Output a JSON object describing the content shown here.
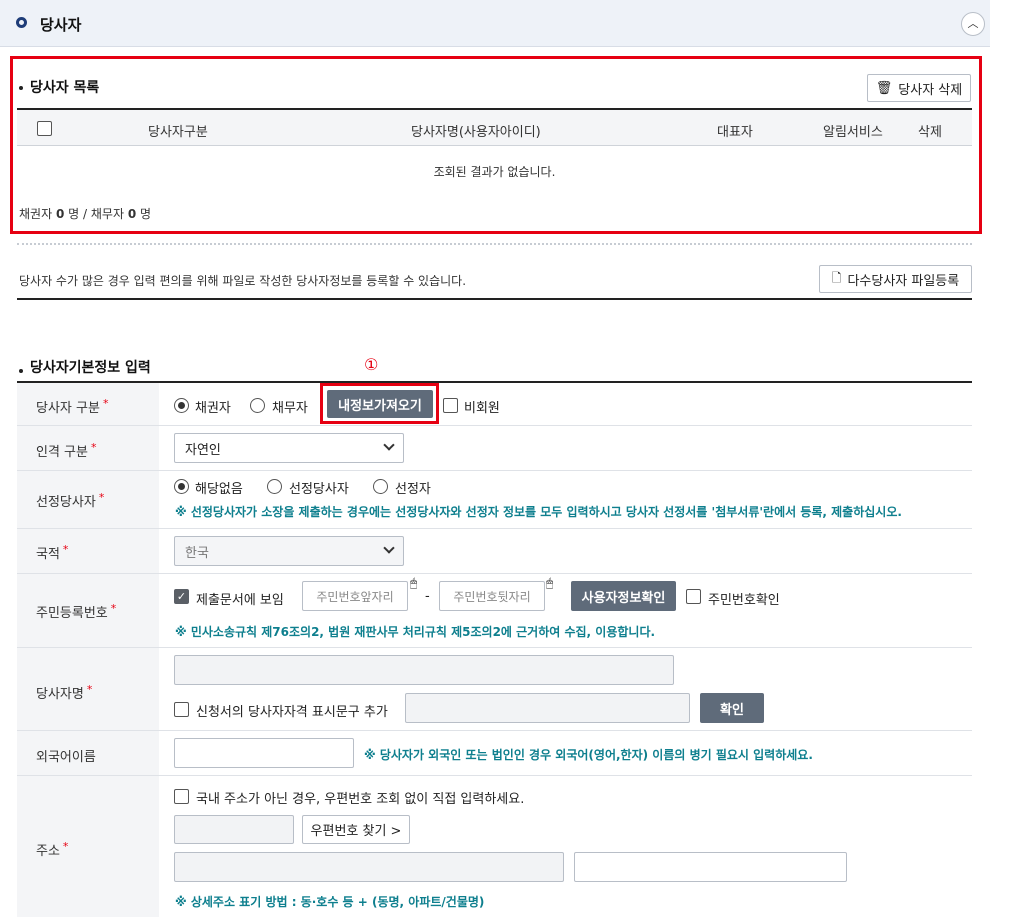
{
  "section": {
    "title": "당사자",
    "collapse_icon": "chevron-up-icon"
  },
  "list": {
    "title": "당사자 목록",
    "delete_button": "당사자 삭제",
    "columns": [
      "당사자구분",
      "당사자명(사용자아이디)",
      "대표자",
      "알림서비스",
      "삭제"
    ],
    "empty_message": "조회된 결과가 없습니다.",
    "summary": {
      "creditor_label": "채권자",
      "creditor_count": "0",
      "unit1": "명 /",
      "debtor_label": "채무자",
      "debtor_count": "0",
      "unit2": "명"
    }
  },
  "bulk": {
    "description": "당사자 수가 많은 경우 입력 편의를 위해 파일로 작성한 당사자정보를 등록할 수 있습니다.",
    "button": "다수당사자 파일등록"
  },
  "form": {
    "title": "당사자기본정보 입력",
    "annotation": "①",
    "party_type": {
      "label": "당사자 구분",
      "required": "*",
      "options": [
        "채권자",
        "채무자"
      ],
      "selected": "채권자",
      "load_button": "내정보가져오기",
      "nonmember": "비회원"
    },
    "person_type": {
      "label": "인격 구분",
      "required": "*",
      "value": "자연인"
    },
    "selected_party": {
      "label": "선정당사자",
      "required": "*",
      "options": [
        "해당없음",
        "선정당사자",
        "선정자"
      ],
      "selected": "해당없음",
      "note": "※ 선정당사자가 소장을 제출하는 경우에는 선정당사자와 선정자 정보를 모두 입력하시고 당사자 선정서를 '첨부서류'란에서 등록, 제출하십시오."
    },
    "nationality": {
      "label": "국적",
      "required": "*",
      "value": "한국"
    },
    "rrn": {
      "label": "주민등록번호",
      "required": "*",
      "show_in_doc": "제출문서에 보임",
      "front_placeholder": "주민번호앞자리",
      "dash": "-",
      "back_placeholder": "주민번호뒷자리",
      "verify_button": "사용자정보확인",
      "confirm_label": "주민번호확인",
      "note": "※ 민사소송규칙 제76조의2, 법원 재판사무 처리규칙 제5조의2에 근거하여 수집, 이용합니다."
    },
    "name": {
      "label": "당사자명",
      "required": "*",
      "add_qualifier": "신청서의 당사자자격 표시문구 추가",
      "confirm_button": "확인"
    },
    "foreign_name": {
      "label": "외국어이름",
      "note": "※ 당사자가 외국인 또는 법인인 경우 외국어(영어,한자) 이름의 병기 필요시 입력하세요."
    },
    "address": {
      "label": "주소",
      "required": "*",
      "direct_input": "국내 주소가 아닌 경우, 우편번호 조회 없이 직접 입력하세요.",
      "zip_button": "우편번호 찾기 >",
      "note": "※ 상세주소 표기 방법 : 동·호수 등 + (동명, 아파트/건물명)"
    }
  }
}
